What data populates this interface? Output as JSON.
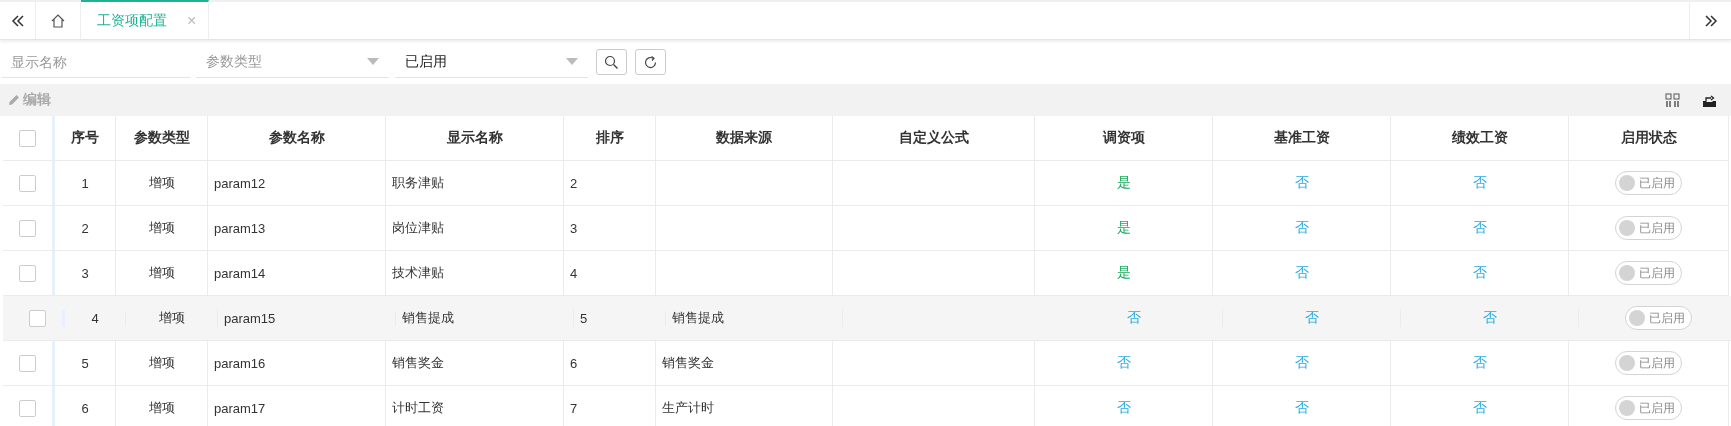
{
  "tabs": [
    {
      "label": "工资项配置",
      "selected": true,
      "close": "×"
    }
  ],
  "filters": {
    "display_name": {
      "placeholder": "显示名称"
    },
    "param_type": {
      "placeholder": "参数类型"
    },
    "status": {
      "value": "已启用"
    }
  },
  "toolbar": {
    "edit": "编辑"
  },
  "table": {
    "columns": [
      "序号",
      "参数类型",
      "参数名称",
      "显示名称",
      "排序",
      "数据来源",
      "自定义公式",
      "调资项",
      "基准工资",
      "绩效工资",
      "启用状态"
    ],
    "header_checked": false,
    "rows": [
      {
        "checked": false,
        "selected": false,
        "no": "1",
        "type": "增项",
        "param": "param12",
        "display": "职务津贴",
        "sort": "2",
        "source": "",
        "formula": "",
        "flags": [
          {
            "text": "是",
            "yes": true
          },
          {
            "text": "否",
            "yes": false
          },
          {
            "text": "否",
            "yes": false
          }
        ],
        "status": {
          "label": "已启用",
          "on": false
        }
      },
      {
        "checked": false,
        "selected": false,
        "no": "2",
        "type": "增项",
        "param": "param13",
        "display": "岗位津贴",
        "sort": "3",
        "source": "",
        "formula": "",
        "flags": [
          {
            "text": "是",
            "yes": true
          },
          {
            "text": "否",
            "yes": false
          },
          {
            "text": "否",
            "yes": false
          }
        ],
        "status": {
          "label": "已启用",
          "on": false
        }
      },
      {
        "checked": false,
        "selected": false,
        "no": "3",
        "type": "增项",
        "param": "param14",
        "display": "技术津贴",
        "sort": "4",
        "source": "",
        "formula": "",
        "flags": [
          {
            "text": "是",
            "yes": true
          },
          {
            "text": "否",
            "yes": false
          },
          {
            "text": "否",
            "yes": false
          }
        ],
        "status": {
          "label": "已启用",
          "on": false
        }
      },
      {
        "checked": false,
        "selected": true,
        "no": "4",
        "type": "增项",
        "param": "param15",
        "display": "销售提成",
        "sort": "5",
        "source": "销售提成",
        "formula": "",
        "flags": [
          {
            "text": "否",
            "yes": false
          },
          {
            "text": "否",
            "yes": false
          },
          {
            "text": "否",
            "yes": false
          }
        ],
        "status": {
          "label": "已启用",
          "on": false
        }
      },
      {
        "checked": false,
        "selected": false,
        "no": "5",
        "type": "增项",
        "param": "param16",
        "display": "销售奖金",
        "sort": "6",
        "source": "销售奖金",
        "formula": "",
        "flags": [
          {
            "text": "否",
            "yes": false
          },
          {
            "text": "否",
            "yes": false
          },
          {
            "text": "否",
            "yes": false
          }
        ],
        "status": {
          "label": "已启用",
          "on": false
        }
      },
      {
        "checked": false,
        "selected": false,
        "no": "6",
        "type": "增项",
        "param": "param17",
        "display": "计时工资",
        "sort": "7",
        "source": "生产计时",
        "formula": "",
        "flags": [
          {
            "text": "否",
            "yes": false
          },
          {
            "text": "否",
            "yes": false
          },
          {
            "text": "否",
            "yes": false
          }
        ],
        "status": {
          "label": "已启用",
          "on": false
        }
      }
    ]
  }
}
